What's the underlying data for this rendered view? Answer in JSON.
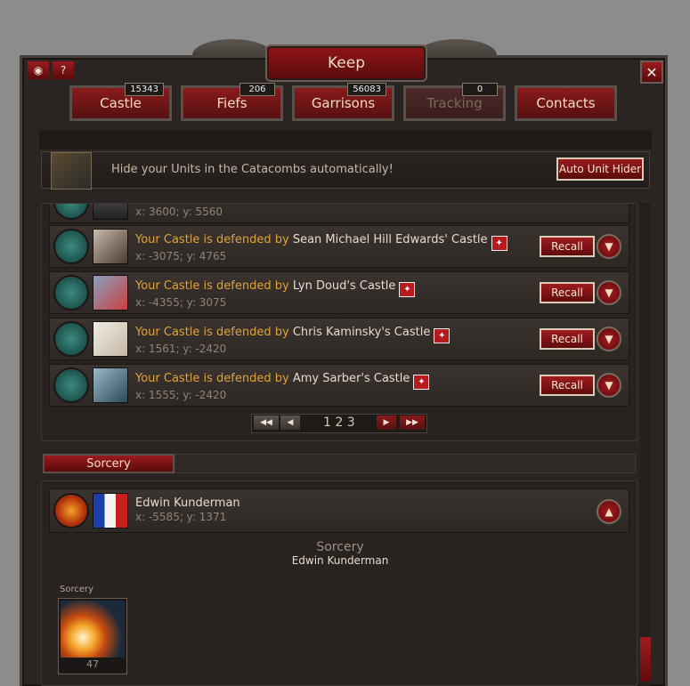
{
  "window": {
    "title": "Keep",
    "close_icon": "close-icon",
    "screenshot_icon": "camera-icon",
    "help_label": "?"
  },
  "tabs": [
    {
      "label": "Castle",
      "count": "15343",
      "enabled": true
    },
    {
      "label": "Fiefs",
      "count": "206",
      "enabled": true
    },
    {
      "label": "Garrisons",
      "count": "56083",
      "enabled": true
    },
    {
      "label": "Tracking",
      "count": "0",
      "enabled": false
    },
    {
      "label": "Contacts",
      "count": "",
      "enabled": true
    }
  ],
  "banner": {
    "text": "Hide your Units in the Catacombs automatically!",
    "button": "Auto Unit Hider"
  },
  "defenders": {
    "partial_row": {
      "coords": "x: 3600; y: 5560"
    },
    "rows": [
      {
        "prefix": "Your Castle is defended by",
        "name": "Sean Michael Hill Edwards' Castle",
        "coords": "x: -3075; y: 4765",
        "button": "Recall"
      },
      {
        "prefix": "Your Castle is defended by",
        "name": "Lyn Doud's Castle",
        "coords": "x: -4355; y: 3075",
        "button": "Recall"
      },
      {
        "prefix": "Your Castle is defended by",
        "name": "Chris Kaminsky's Castle",
        "coords": "x: 1561; y: -2420",
        "button": "Recall"
      },
      {
        "prefix": "Your Castle is defended by",
        "name": "Amy Sarber's Castle",
        "coords": "x: 1555; y: -2420",
        "button": "Recall"
      }
    ]
  },
  "pagination": {
    "pages": "1 2 3",
    "current": 1
  },
  "sorcery": {
    "tab": "Sorcery",
    "player": {
      "name": "Edwin Kunderman",
      "coords": "x: -5585; y: 1371"
    },
    "title": "Sorcery",
    "owner": "Edwin Kunderman",
    "unit": {
      "label": "Sorcery",
      "count": "47"
    }
  },
  "colors": {
    "accent": "#8a1a1b",
    "gold_text": "#e0a23a"
  }
}
